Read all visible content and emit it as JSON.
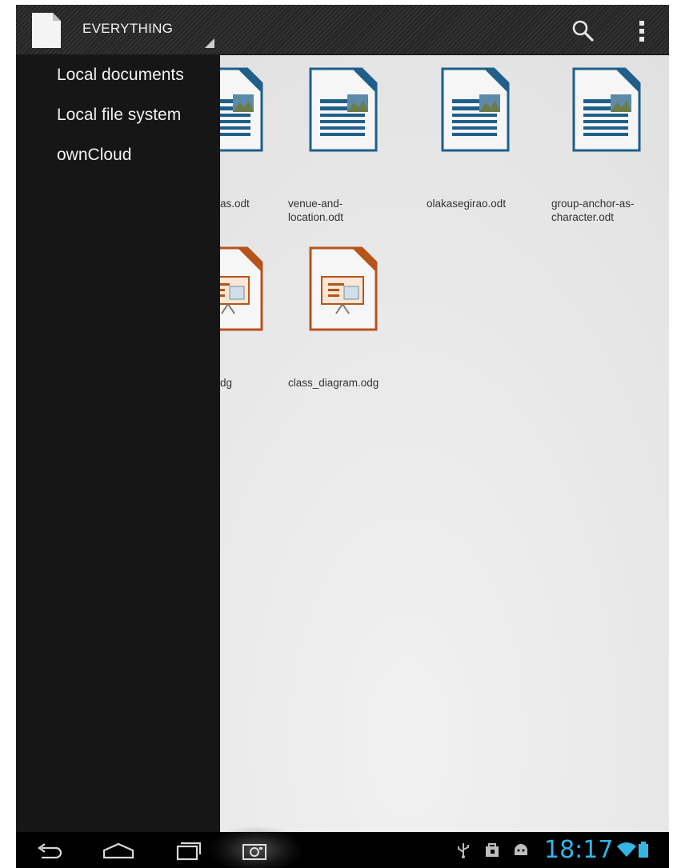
{
  "action_bar": {
    "title": "EVERYTHING",
    "icons": [
      "app-document-icon",
      "search-icon",
      "overflow-menu-icon"
    ]
  },
  "drawer": {
    "items": [
      {
        "label": "Local documents"
      },
      {
        "label": "Local file system"
      },
      {
        "label": "ownCloud"
      }
    ]
  },
  "files": [
    {
      "label": "as.odt",
      "type": "writer"
    },
    {
      "label": "venue-and-\nlocation.odt",
      "type": "writer"
    },
    {
      "label": "olakasegirao.odt",
      "type": "writer"
    },
    {
      "label": "group-anchor-as-\ncharacter.odt",
      "type": "writer"
    },
    {
      "label": "dg",
      "type": "draw"
    },
    {
      "label": "class_diagram.odg",
      "type": "draw"
    }
  ],
  "status_bar": {
    "time": "18:17",
    "icons": [
      "usb-icon",
      "store-icon",
      "android-debug-icon",
      "wifi-icon",
      "battery-icon"
    ]
  },
  "nav_bar": {
    "icons": [
      "back-icon",
      "home-icon",
      "recent-apps-icon",
      "screenshot-icon"
    ]
  },
  "colors": {
    "writer_accent": "#1f5f8a",
    "draw_accent": "#b8531a",
    "clock": "#33b5e5",
    "drawer_bg": "#161616"
  }
}
